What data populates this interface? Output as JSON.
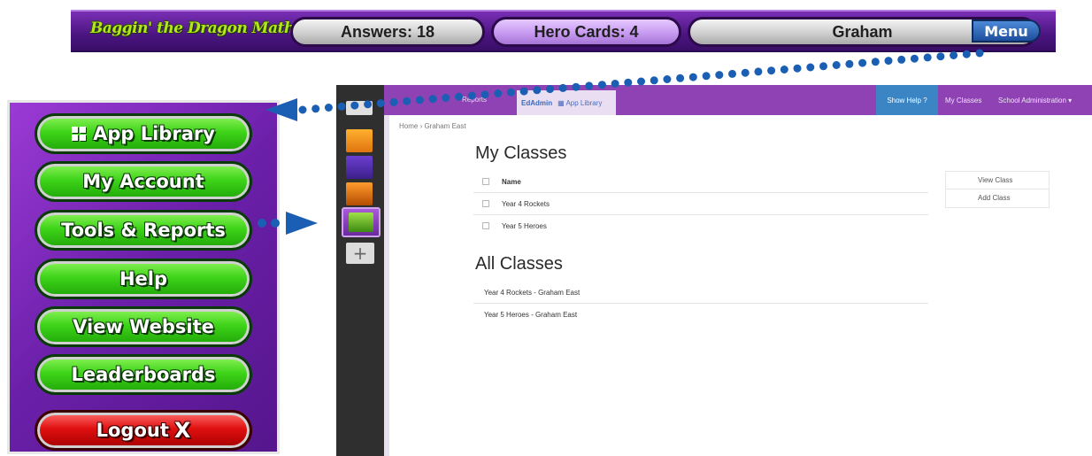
{
  "topbar": {
    "logo": "Baggin' the Dragon Maths",
    "answers": "Answers: 18",
    "hero_cards": "Hero Cards: 4",
    "player_name": "Graham",
    "menu_label": "Menu"
  },
  "menu": {
    "items": [
      {
        "label": "App Library"
      },
      {
        "label": "My Account"
      },
      {
        "label": "Tools & Reports"
      },
      {
        "label": "Help"
      },
      {
        "label": "View Website"
      },
      {
        "label": "Leaderboards"
      },
      {
        "label": "Logout"
      }
    ],
    "logout_icon": "X"
  },
  "screenshot": {
    "nav": {
      "reports_tab": "Reports",
      "brand": "EdAdmin",
      "app_library": "App Library",
      "show_help": "Show Help ?",
      "my_classes": "My Classes",
      "school_admin": "School Administration ▾"
    },
    "breadcrumb": "Home › Graham East",
    "my_classes": {
      "heading": "My Classes",
      "header": "Name",
      "rows": [
        "Year 4 Rockets",
        "Year 5 Heroes"
      ]
    },
    "actions": [
      "View Class",
      "Add Class"
    ],
    "all_classes": {
      "heading": "All Classes",
      "rows": [
        "Year 4 Rockets - Graham East",
        "Year 5 Heroes - Graham East"
      ]
    },
    "plus": "+"
  },
  "colors": {
    "bar_purple": "#5a1a96",
    "button_green": "#3fd419",
    "logout_red": "#e01010",
    "arrow_blue": "#1b5fb4",
    "nav_purple": "#8e42b3"
  }
}
